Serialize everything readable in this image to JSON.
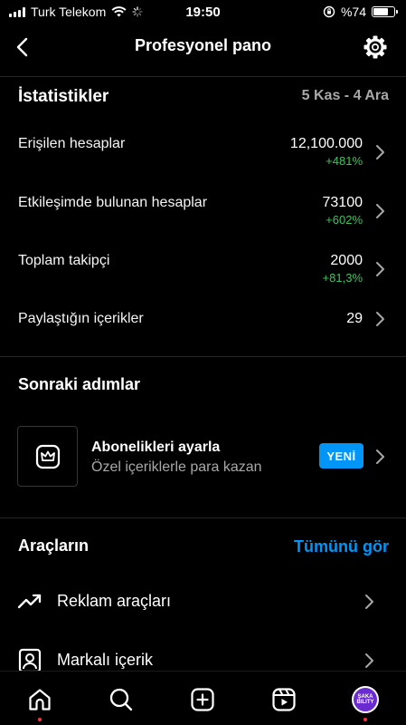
{
  "status_bar": {
    "carrier": "Turk Telekom",
    "time": "19:50",
    "battery": "%74",
    "battery_level": 0.74
  },
  "header": {
    "title": "Profesyonel pano",
    "back_icon": "chevron-left-icon",
    "settings_icon": "gear-icon"
  },
  "stats": {
    "title": "İstatistikler",
    "date_range": "5 Kas - 4 Ara",
    "rows": [
      {
        "label": "Erişilen hesaplar",
        "value": "12,100.000",
        "change": "+481%"
      },
      {
        "label": "Etkileşimde bulunan hesaplar",
        "value": "73100",
        "change": "+602%"
      },
      {
        "label": "Toplam takipçi",
        "value": "2000",
        "change": "+81,3%"
      },
      {
        "label": "Paylaştığın içerikler",
        "value": "29",
        "change": ""
      }
    ]
  },
  "next_steps": {
    "title": "Sonraki adımlar",
    "card": {
      "title": "Abonelikleri ayarla",
      "subtitle": "Özel içeriklerle para kazan",
      "badge": "YENİ",
      "icon": "crown-icon"
    }
  },
  "tools": {
    "title": "Araçların",
    "see_all": "Tümünü gör",
    "items": [
      {
        "label": "Reklam araçları",
        "icon": "trending-up-icon"
      },
      {
        "label": "Markalı içerik",
        "icon": "branded-content-icon"
      }
    ]
  },
  "bottom_nav": {
    "items": [
      "home-icon",
      "search-icon",
      "create-icon",
      "reels-icon",
      "profile-avatar"
    ],
    "avatar_text": "ŞAKA BILITY",
    "accent": "#ff3040"
  },
  "colors": {
    "positive": "#3ec45e",
    "link": "#0095f6",
    "muted": "#a8a8a8"
  }
}
